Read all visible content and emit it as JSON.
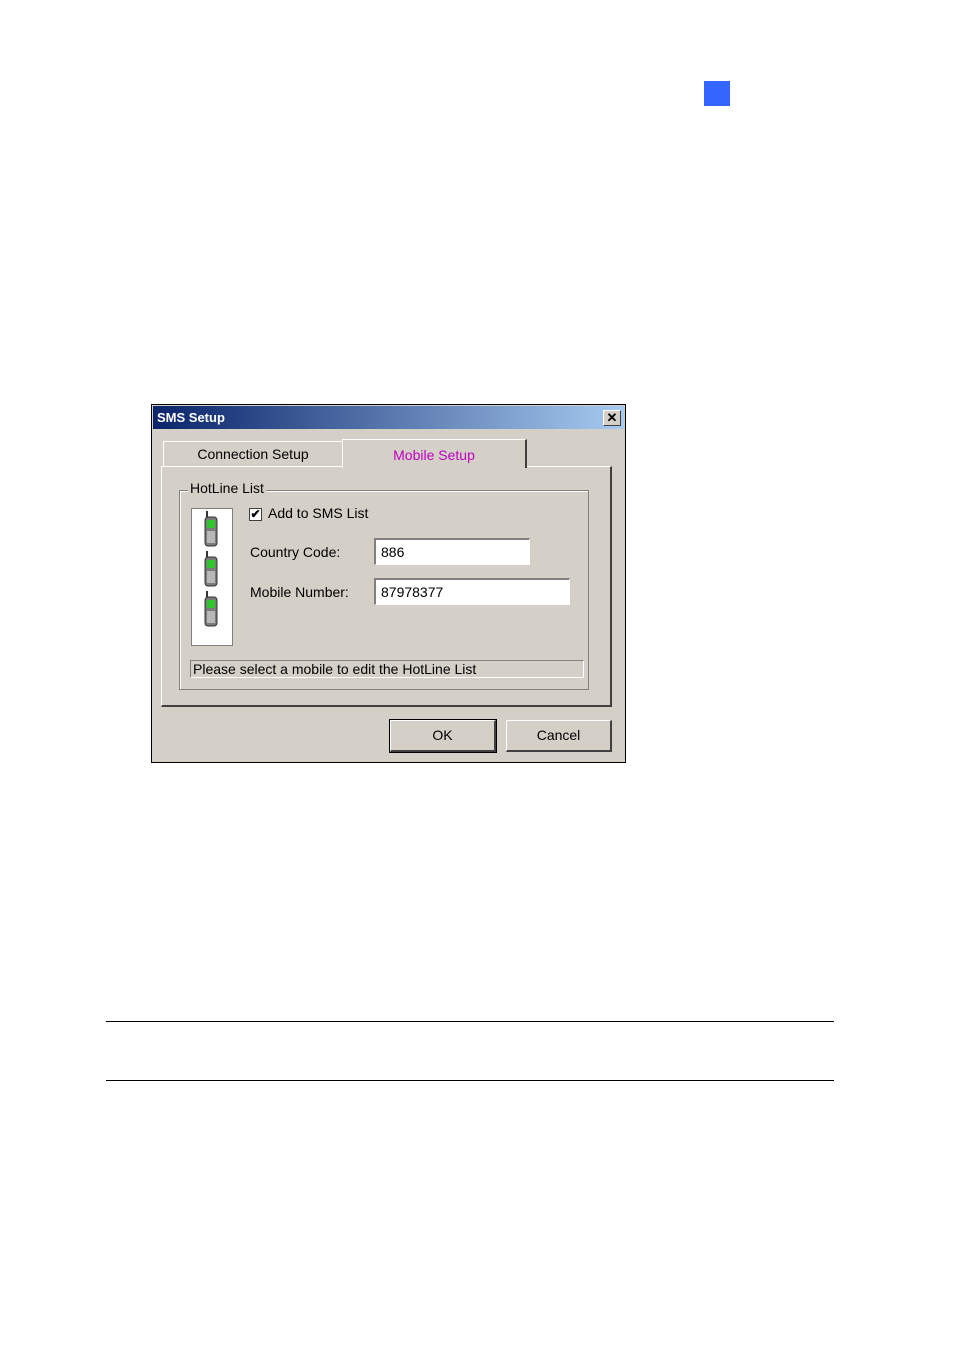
{
  "dialog": {
    "title": "SMS Setup",
    "close_glyph": "✕",
    "tabs": [
      {
        "label": "Connection Setup"
      },
      {
        "label": "Mobile Setup"
      }
    ],
    "group_title": "HotLine List",
    "checkbox": {
      "label": "Add to SMS List",
      "checked": true,
      "mark": "✔"
    },
    "country_code": {
      "label": "Country Code:",
      "value": "886"
    },
    "mobile_number": {
      "label": "Mobile Number:",
      "value": "87978377"
    },
    "status": "Please select a mobile to edit the HotLine List",
    "buttons": {
      "ok": "OK",
      "cancel": "Cancel"
    },
    "phone_icons": [
      "mobile-phone-icon",
      "mobile-phone-icon",
      "mobile-phone-icon"
    ]
  },
  "colors": {
    "chapter_marker": "#3366ff",
    "active_tab_text": "#c000c0",
    "titlebar_start": "#0a246a",
    "titlebar_end": "#a6caf0",
    "dialog_face": "#d4d0c8"
  }
}
